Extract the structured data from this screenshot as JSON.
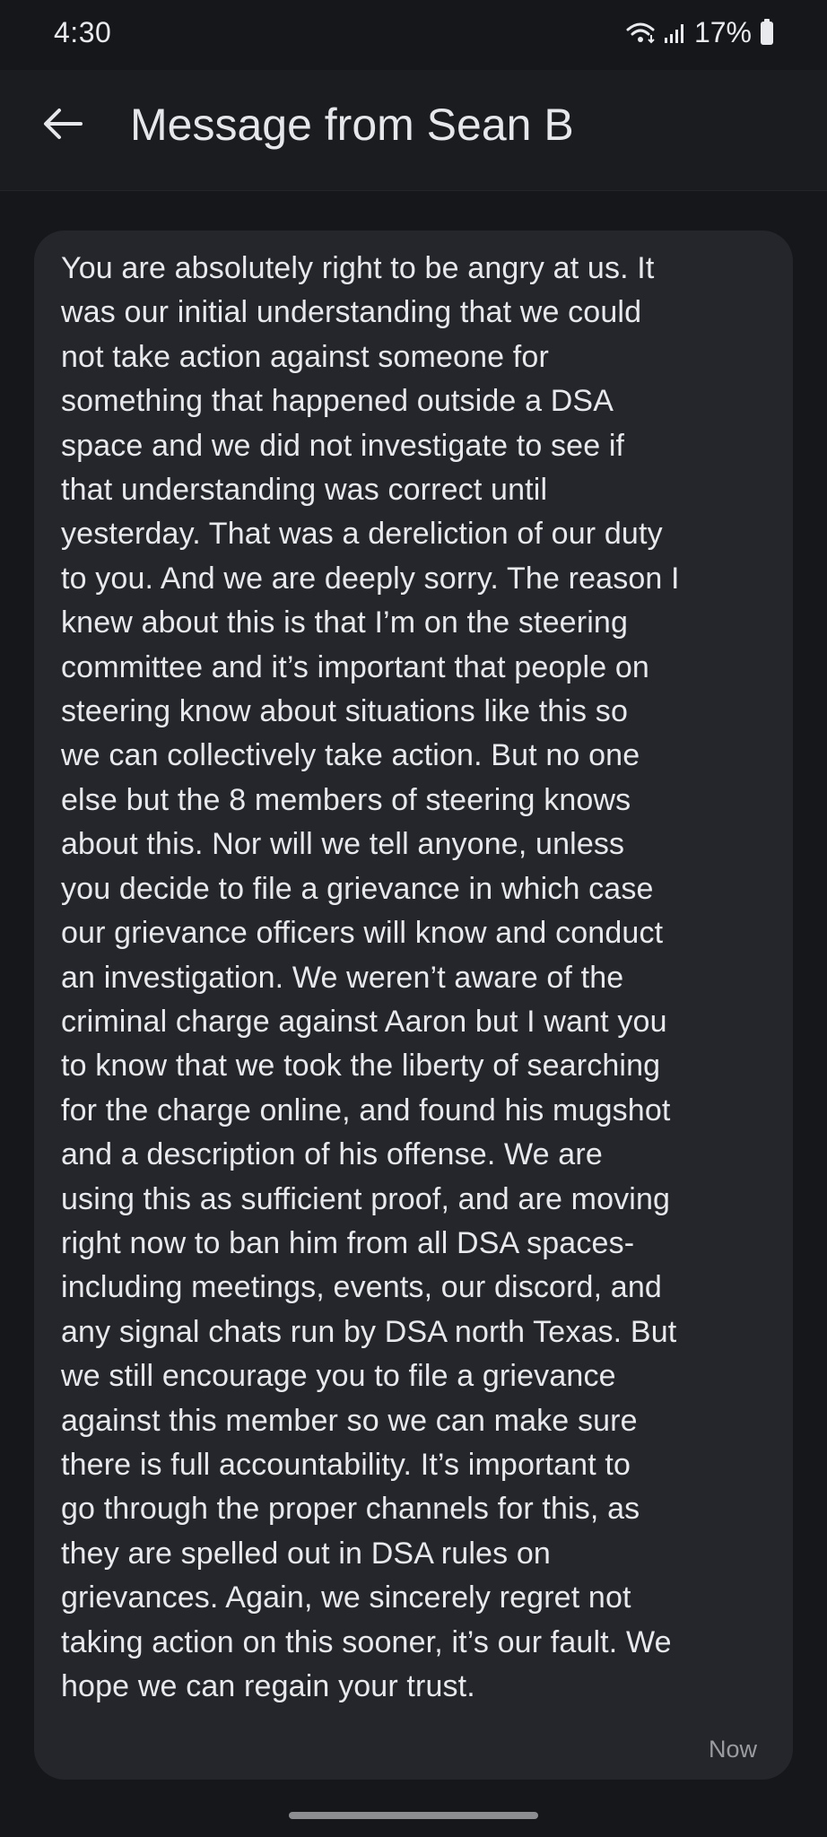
{
  "status_bar": {
    "time": "4:30",
    "battery_text": "17%"
  },
  "app_bar": {
    "title": "Message from Sean B",
    "back_icon": "arrow-back-icon"
  },
  "message": {
    "body": "You are absolutely right to be angry at us. It\nwas our initial understanding that we could\nnot take action against someone for\nsomething that happened outside a DSA\nspace and we did not investigate to see if\nthat understanding was correct until\nyesterday. That was a dereliction of our duty\nto you. And we are deeply sorry. The reason I\nknew about this is that I’m on the steering\ncommittee and it’s important that people on\nsteering know about situations like this so\nwe can collectively take action. But no one\nelse but the 8 members of steering knows\nabout this. Nor will we tell anyone, unless\nyou decide to file a grievance in which case\nour grievance officers will know and conduct\nan investigation. We weren’t aware of the\ncriminal charge against Aaron but I want you\nto know that we took the liberty of searching\nfor the charge online, and found his mugshot\nand a description of his offense. We are\nusing this as sufficient proof, and are moving\nright now to ban him from all DSA spaces-\nincluding meetings, events, our discord, and\nany signal chats run by DSA north Texas. But\nwe still encourage you to file a grievance\nagainst this member so we can make sure\nthere is full accountability. It’s important to\ngo through the proper channels for this, as\nthey are spelled out in DSA rules on\ngrievances. Again, we sincerely regret not\ntaking action on this sooner, it’s our fault. We\nhope we can regain your trust.",
    "timestamp": "Now"
  },
  "colors": {
    "background": "#16171b",
    "app_bar": "#1b1c20",
    "card": "#25262b",
    "text": "#e8e9ed",
    "muted": "#9a9ba0"
  }
}
